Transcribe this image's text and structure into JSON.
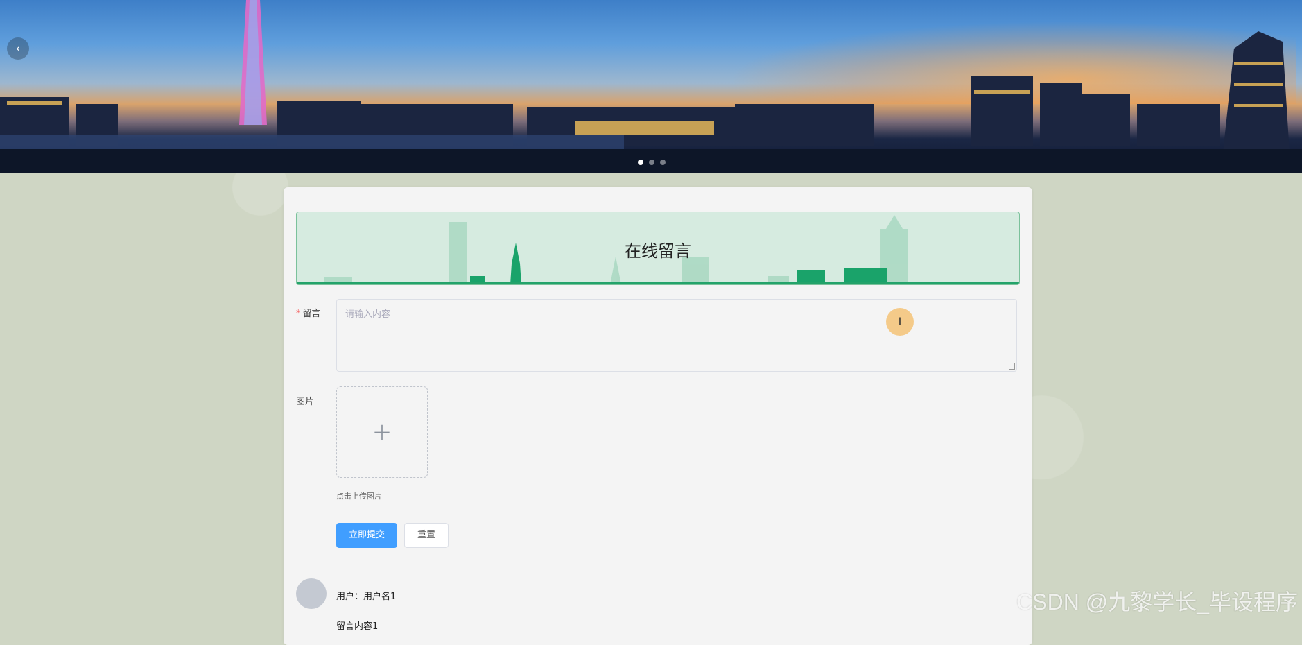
{
  "banner": {
    "prev_icon": "chevron-left-icon",
    "prev_glyph": "‹",
    "indicators": 3,
    "active_indicator": 0
  },
  "card": {
    "title": "在线留言",
    "form": {
      "message_label": "留言",
      "required_mark": "*",
      "message_placeholder": "请输入内容",
      "image_label": "图片",
      "upload_icon": "plus-icon",
      "upload_glyph": "+",
      "upload_tip": "点击上传图片",
      "submit_label": "立即提交",
      "reset_label": "重置"
    },
    "comments": [
      {
        "user_prefix": "用户：",
        "user": "用户名1",
        "content": "留言内容1"
      }
    ]
  },
  "cursor": {
    "icon": "text-cursor-icon",
    "glyph": "I"
  },
  "watermark": "CSDN @九黎学长_毕设程序",
  "colors": {
    "primary": "#409eff",
    "title_border": "#7bc19b",
    "title_bg": "#d6ebe0",
    "skyline": "#1aa36a",
    "page_bg": "#cfd6c4"
  }
}
